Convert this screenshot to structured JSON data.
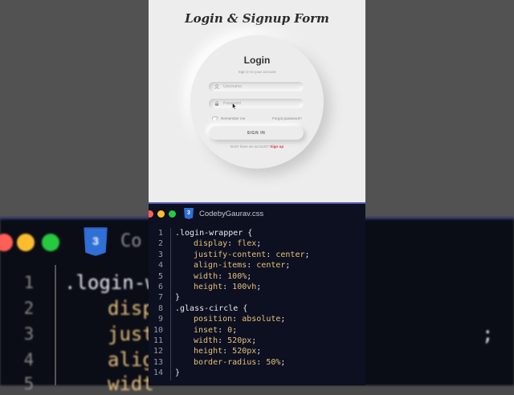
{
  "form": {
    "title": "Login & Signup Form",
    "heading": "Login",
    "subtitle": "Sign in to your account",
    "username_placeholder": "Username",
    "password_placeholder": "Password",
    "remember_label": "Remember me",
    "forgot_label": "Forgot password?",
    "signin_label": "SIGN IN",
    "signup_prompt": "Don't have an account?",
    "signup_link": "Sign up"
  },
  "editor": {
    "filename": "CodebyGaurav.css",
    "icon_label": "3",
    "window_colors": {
      "close": "#ff5f56",
      "minimize": "#ffbd2e",
      "maximize": "#27c93f"
    },
    "lines": [
      {
        "n": "1",
        "selector": ".login-wrapper {"
      },
      {
        "n": "2",
        "prop": "display",
        "value": "flex"
      },
      {
        "n": "3",
        "prop": "justify-content",
        "value": "center"
      },
      {
        "n": "4",
        "prop": "align-items",
        "value": "center"
      },
      {
        "n": "5",
        "prop": "width",
        "value": "100%"
      },
      {
        "n": "6",
        "prop": "height",
        "value": "100vh"
      },
      {
        "n": "7",
        "brace": "}"
      },
      {
        "n": "8",
        "selector": ".glass-circle {"
      },
      {
        "n": "9",
        "prop": "position",
        "value": "absolute"
      },
      {
        "n": "10",
        "prop": "inset",
        "value": "0"
      },
      {
        "n": "11",
        "prop": "width",
        "value": "520px"
      },
      {
        "n": "12",
        "prop": "height",
        "value": "520px"
      },
      {
        "n": "13",
        "prop": "border-radius",
        "value": "50%"
      },
      {
        "n": "14",
        "brace": "}"
      }
    ]
  },
  "background": {
    "file": "Co",
    "icon_label": "3",
    "ln": [
      "1",
      "2",
      "3",
      "4",
      "5"
    ],
    "code": [
      ".login-w",
      "disp",
      "just",
      "alig",
      "widt"
    ],
    "tail": ";"
  },
  "colors": {
    "accent_border": "#5355b0",
    "signup_link": "#d93a3a",
    "editor_bg": "#0d1020"
  }
}
